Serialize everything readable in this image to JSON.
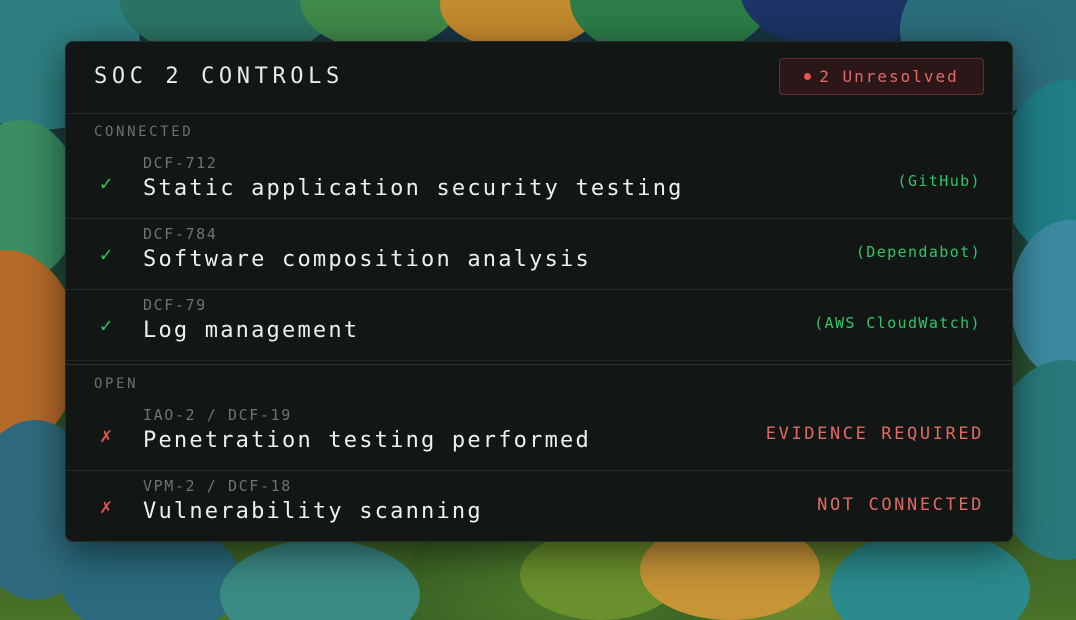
{
  "panel": {
    "title": "SOC 2 CONTROLS",
    "badge": "2 Unresolved"
  },
  "sections": {
    "connected_label": "CONNECTED",
    "open_label": "OPEN"
  },
  "connected": [
    {
      "code": "DCF-712",
      "name": "Static application security testing",
      "source": "(GitHub)",
      "status_icon": "check-icon"
    },
    {
      "code": "DCF-784",
      "name": "Software composition analysis",
      "source": "(Dependabot)",
      "status_icon": "check-icon"
    },
    {
      "code": "DCF-79",
      "name": "Log management",
      "source": "(AWS CloudWatch)",
      "status_icon": "check-icon"
    }
  ],
  "open": [
    {
      "code": "IAO-2 / DCF-19",
      "name": "Penetration testing performed",
      "status": "EVIDENCE REQUIRED",
      "status_icon": "cross-icon"
    },
    {
      "code": "VPM-2 / DCF-18",
      "name": "Vulnerability scanning",
      "status": "NOT CONNECTED",
      "status_icon": "cross-icon"
    }
  ],
  "glyphs": {
    "check": "✓",
    "cross": "✗"
  },
  "colors": {
    "success": "#2fc66a",
    "danger": "#e5554f",
    "panel": "#121614"
  }
}
